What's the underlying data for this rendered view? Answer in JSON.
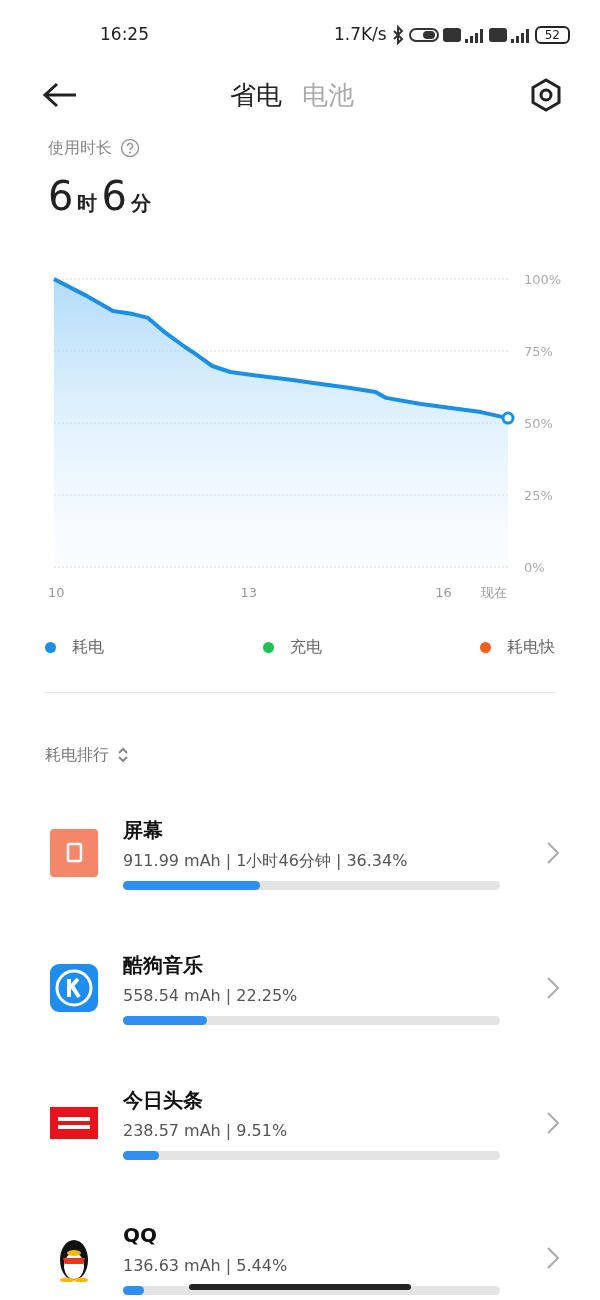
{
  "status_bar": {
    "time": "16:25",
    "speed": "1.7K/s",
    "battery": "52"
  },
  "tabs": [
    {
      "label": "省电",
      "selected": true
    },
    {
      "label": "电池",
      "selected": false
    }
  ],
  "usage": {
    "label": "使用时长",
    "hours": "6",
    "hours_unit": "时",
    "minutes": "6",
    "minutes_unit": "分"
  },
  "chart_data": {
    "type": "area",
    "x": [
      10,
      10.48,
      10.91,
      11.22,
      11.45,
      11.72,
      12.02,
      12.18,
      12.44,
      12.72,
      13.18,
      13.65,
      14.11,
      14.57,
      14.96,
      15.12,
      15.66,
      16.12,
      16.58,
      17
    ],
    "series": [
      {
        "name": "耗电",
        "color": "#1a8fe3",
        "values": [
          100,
          94.4,
          88.9,
          87.8,
          86.5,
          81.3,
          76.4,
          74,
          69.8,
          67.7,
          66.3,
          65,
          63.5,
          62.2,
          60.8,
          58.7,
          56.6,
          55.2,
          53.8,
          51.7
        ]
      }
    ],
    "grid": true,
    "xlim": [
      10,
      17
    ],
    "ylim": [
      0,
      100
    ],
    "xticks": [
      10,
      13,
      16,
      {
        "value": 16.7,
        "label": "现在"
      }
    ],
    "yticks": [
      {
        "value": 0,
        "label": "0%"
      },
      {
        "value": 25,
        "label": "25%"
      },
      {
        "value": 50,
        "label": "50%"
      },
      {
        "value": 75,
        "label": "75%"
      },
      {
        "value": 100,
        "label": "100%"
      }
    ]
  },
  "legend": [
    {
      "label": "充电",
      "color": "#1ec252"
    },
    {
      "label": "耗电快",
      "color": "#f2601e"
    }
  ],
  "ranking": {
    "label": "耗电排行"
  },
  "apps": [
    {
      "kind": "screen",
      "name": "屏幕",
      "detail": "911.99 mAh | 1小时46分钟 | 36.34%",
      "level": 0.3634
    },
    {
      "kind": "kugou",
      "name": "酷狗音乐",
      "detail": "558.54 mAh | 22.25%",
      "level": 0.2225
    },
    {
      "kind": "toutiao",
      "name": "今日头条",
      "detail": "238.57 mAh | 9.51%",
      "level": 0.0951
    },
    {
      "kind": "qq",
      "name": "QQ",
      "detail": "136.63 mAh | 5.44%",
      "level": 0.0544
    }
  ]
}
